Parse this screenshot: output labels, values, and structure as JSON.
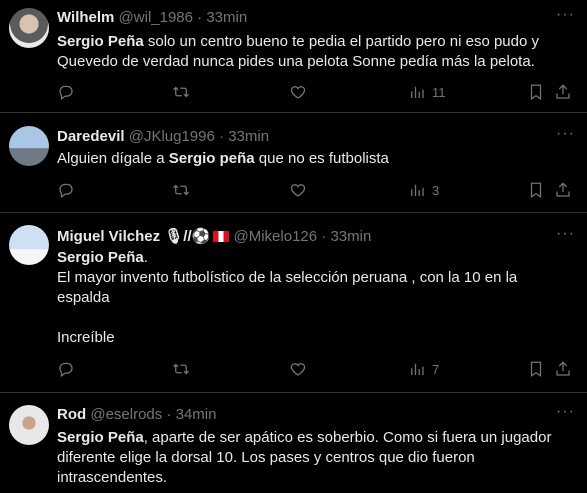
{
  "tweets": [
    {
      "name": "Wilhelm",
      "handle": "@wil_1986",
      "separator": "·",
      "time": "33min",
      "lines": [
        {
          "bold": "Sergio Peña",
          "text": " solo un centro bueno te pedia el partido pero ni eso pudo y"
        },
        {
          "bold": "",
          "text": "Quevedo de verdad nunca pides una pelota Sonne pedía más la pelota."
        }
      ],
      "views": "11"
    },
    {
      "name": "Daredevil",
      "handle": "@JKlug1996",
      "separator": "·",
      "time": "33min",
      "lines": [
        {
          "pre": "Alguien dígale a ",
          "bold": "Sergio peña",
          "text": " que no es futbolista"
        }
      ],
      "views": "3"
    },
    {
      "name": "Miguel Vilchez",
      "name_extra": "🎙//⚽",
      "handle": "@Mikelo126",
      "separator": "·",
      "time": "33min",
      "lines": [
        {
          "bold": "Sergio Peña",
          "text": "."
        },
        {
          "bold": "",
          "text": "El mayor invento futbolístico de la selección peruana , con la 10 en la"
        },
        {
          "bold": "",
          "text": "espalda"
        },
        {
          "bold": "",
          "text": ""
        },
        {
          "bold": "",
          "text": "Increíble"
        }
      ],
      "views": "7"
    },
    {
      "name": "Rod",
      "handle": "@eselrods",
      "separator": "·",
      "time": "34min",
      "lines": [
        {
          "bold": "Sergio Peña",
          "text": ", aparte de ser apático es soberbio. Como si fuera un jugador"
        },
        {
          "bold": "",
          "text": "diferente elige la dorsal 10. Los pases y centros que dio fueron"
        },
        {
          "bold": "",
          "text": "intrascendentes."
        }
      ]
    }
  ],
  "more_label": "···",
  "colors": {
    "background": "#000000",
    "text": "#e7e9ea",
    "muted": "#71767b",
    "divider": "#2f3336"
  }
}
